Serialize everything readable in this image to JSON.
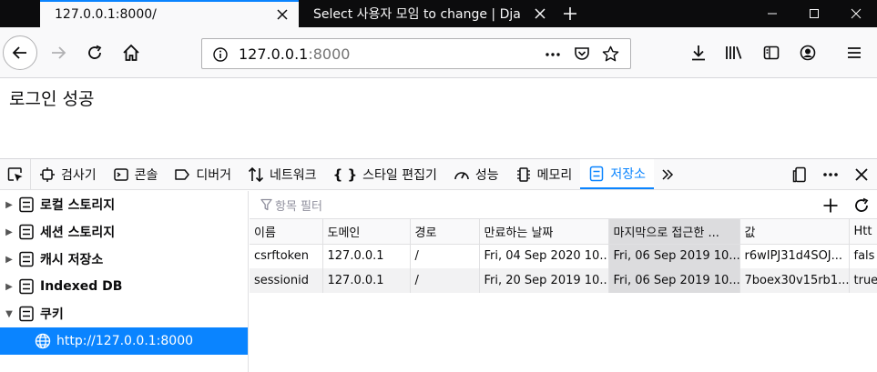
{
  "browser": {
    "tabs": [
      {
        "title": "127.0.0.1:8000/",
        "active": true
      },
      {
        "title": "Select 사용자 모임 to change | Dja",
        "active": false
      }
    ],
    "url": {
      "host": "127.0.0.1",
      "port": ":8000"
    }
  },
  "page": {
    "message": "로그인 성공"
  },
  "devtools": {
    "tabs": [
      {
        "label": "검사기",
        "icon": "inspector-icon"
      },
      {
        "label": "콘솔",
        "icon": "console-icon"
      },
      {
        "label": "디버거",
        "icon": "debugger-icon"
      },
      {
        "label": "네트워크",
        "icon": "network-icon"
      },
      {
        "label": "스타일 편집기",
        "icon": "style-editor-icon"
      },
      {
        "label": "성능",
        "icon": "performance-icon"
      },
      {
        "label": "메모리",
        "icon": "memory-icon"
      },
      {
        "label": "저장소",
        "icon": "storage-icon",
        "active": true
      }
    ],
    "storage_tree": [
      {
        "label": "로컬 스토리지"
      },
      {
        "label": "세션 스토리지"
      },
      {
        "label": "캐시 저장소"
      },
      {
        "label": "Indexed DB"
      },
      {
        "label": "쿠키",
        "expanded": true,
        "children": [
          {
            "label": "http://127.0.0.1:8000",
            "selected": true
          }
        ]
      }
    ],
    "filter_placeholder": "항목 필터",
    "table": {
      "columns": [
        "이름",
        "도메인",
        "경로",
        "만료하는 날짜",
        "마지막으로 접근한 ...",
        "값",
        "Htt"
      ],
      "rows": [
        [
          "csrftoken",
          "127.0.0.1",
          "/",
          "Fri, 04 Sep 2020 10...",
          "Fri, 06 Sep 2019 10...",
          "r6wIPJ31d4SOJ...",
          "fals"
        ],
        [
          "sessionid",
          "127.0.0.1",
          "/",
          "Fri, 20 Sep 2019 10...",
          "Fri, 06 Sep 2019 10...",
          "7boex30v15rb1...",
          "true"
        ]
      ]
    }
  }
}
